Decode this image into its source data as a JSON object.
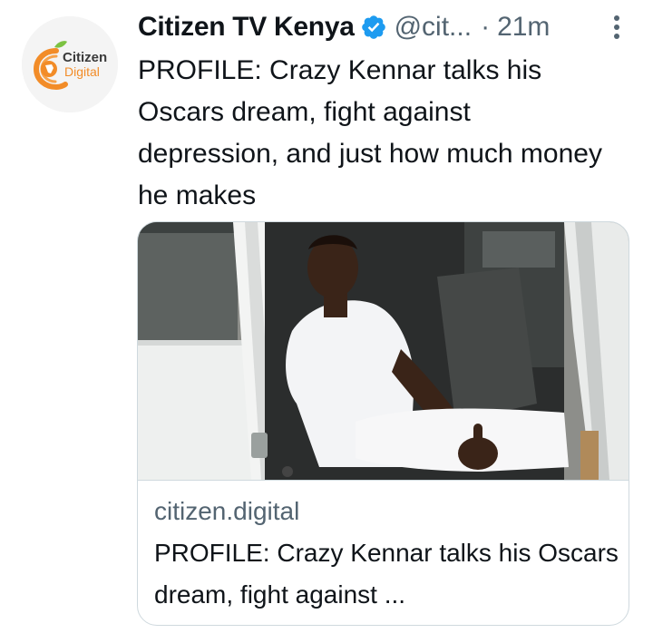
{
  "tweet": {
    "author": {
      "name": "Citizen TV Kenya",
      "handle": "@cit...",
      "verified": true,
      "avatar_logo_text": [
        "Citizen",
        "Digital"
      ]
    },
    "separator": "·",
    "timestamp": "21m",
    "more_icon": "more-vertical-icon",
    "text": "PROFILE: Crazy Kennar talks his Oscars dream, fight against depression, and just how much money he makes",
    "card": {
      "domain": "citizen.digital",
      "title": "PROFILE: Crazy Kennar talks his Oscars dream, fight against ...",
      "image_alt": "man in white outfit sitting in a car doorway giving thumbs up"
    }
  },
  "colors": {
    "text_primary": "#0f1419",
    "text_secondary": "#536471",
    "verified_blue": "#1d9bf0",
    "border": "#cfd9de",
    "brand_orange": "#f28c28",
    "brand_green": "#7cc242"
  }
}
